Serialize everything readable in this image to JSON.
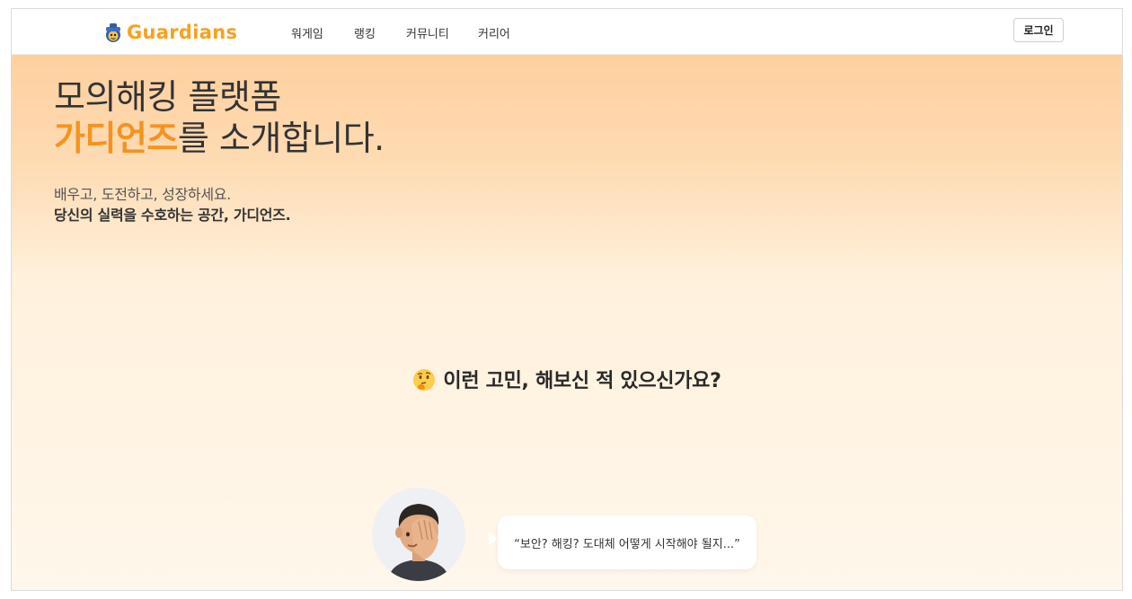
{
  "nav": {
    "logo_text": "Guardians",
    "logo_icon": "guardian-mascot-icon",
    "items": [
      "워게임",
      "랭킹",
      "커뮤니티",
      "커리어"
    ],
    "login_label": "로그인"
  },
  "hero": {
    "title_line1": "모의해킹 플랫폼",
    "title_accent": "가디언즈",
    "title_rest": "를 소개합니다.",
    "subtitle_line1": "배우고, 도전하고, 성장하세요.",
    "subtitle_line2": "당신의 실력을 수호하는 공간, 가디언즈."
  },
  "question": {
    "emoji_icon": "thinking-face-icon",
    "text": "이런 고민, 해보신 적 있으신가요?"
  },
  "testimonial": {
    "avatar_icon": "facepalm-person-avatar",
    "quote": "“보안? 해킹? 도대체 어떻게 시작해야 될지...”"
  },
  "colors": {
    "accent": "#f7921e",
    "logo": "#f7a11d",
    "gradient_top": "#fed09f",
    "gradient_bottom": "#fff7ec"
  }
}
